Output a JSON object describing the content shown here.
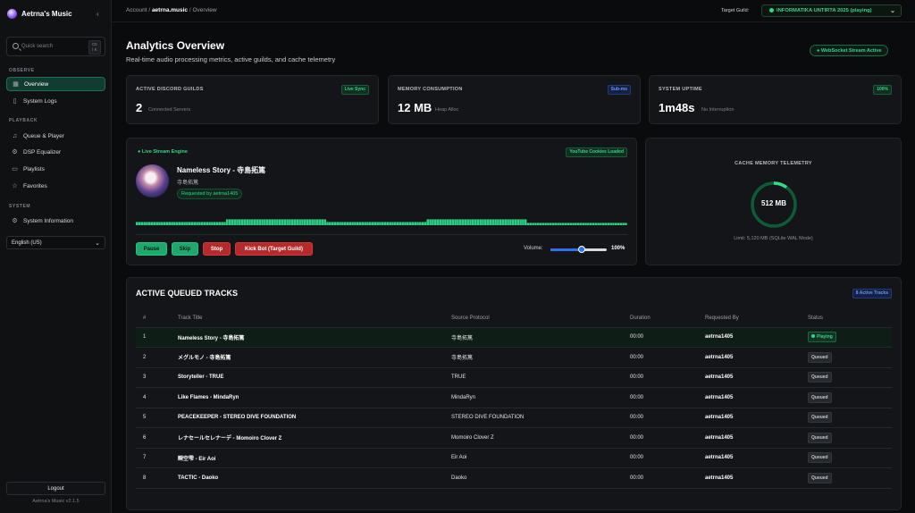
{
  "app": {
    "name": "Aetrna's Music",
    "version": "Aetrna's Music v2.1.5"
  },
  "search": {
    "placeholder": "Quick search",
    "shortcut": "Ctrl K"
  },
  "sidebar": {
    "sections": [
      {
        "title": "OBSERVE",
        "items": [
          {
            "label": "Overview",
            "icon": "grid-icon",
            "active": true
          },
          {
            "label": "System Logs",
            "icon": "file-icon"
          }
        ]
      },
      {
        "title": "PLAYBACK",
        "items": [
          {
            "label": "Queue & Player",
            "icon": "music-icon"
          },
          {
            "label": "DSP Equalizer",
            "icon": "sliders-icon"
          },
          {
            "label": "Playlists",
            "icon": "bookmark-icon"
          },
          {
            "label": "Favorites",
            "icon": "star-icon"
          }
        ]
      },
      {
        "title": "SYSTEM",
        "items": [
          {
            "label": "System Information",
            "icon": "gear-icon"
          }
        ]
      }
    ],
    "language": "English (US)",
    "logout": "Logout"
  },
  "breadcrumb": {
    "root": "Account",
    "guild": "aetrna.music",
    "page": "Overview"
  },
  "target_guild": {
    "label": "Target Guild:",
    "value": "INFORMATIKA UNTIRTA 2025 (playing)"
  },
  "header": {
    "title": "Analytics Overview",
    "subtitle": "Real-time audio processing metrics, active guilds, and cache telemetry",
    "ws_badge": "WebSocket Stream Active"
  },
  "stats": [
    {
      "label": "ACTIVE DISCORD GUILDS",
      "value": "2",
      "sub": "Connected Servers",
      "badge": "Live Sync",
      "badge_color": "green"
    },
    {
      "label": "MEMORY CONSUMPTION",
      "value": "12 MB",
      "sub": "Heap Alloc",
      "badge": "Sub-ms",
      "badge_color": "blue"
    },
    {
      "label": "SYSTEM UPTIME",
      "value": "1m48s",
      "sub": "No Interruption",
      "badge": "100%",
      "badge_color": "green"
    }
  ],
  "player": {
    "engine_label": "Live Stream Engine",
    "cookies_badge": "YouTube Cookies Loaded",
    "track": "Nameless Story - 寺島拓篤",
    "artist": "寺島拓篤",
    "requested_by": "Requested by aetrna1405",
    "controls": {
      "pause": "Pause",
      "skip": "Skip",
      "stop": "Stop",
      "kick": "Kick Bot (Target Guild)"
    },
    "volume_label": "Volume:",
    "volume_value": "100%",
    "volume_fraction": 0.55,
    "waveform": [
      0.3,
      0.3,
      0.3,
      0.3,
      0.3,
      0.3,
      0.3,
      0.3,
      0.3,
      0.3,
      0.3,
      0.3,
      0.3,
      0.3,
      0.3,
      0.3,
      0.3,
      0.3,
      0.3,
      0.3,
      0.3,
      0.3,
      0.3,
      0.3,
      0.3,
      0.3,
      0.3,
      0.3,
      0.3,
      0.3,
      0.3,
      0.3,
      0.3,
      0.3,
      0.3,
      0.3,
      0.55,
      0.55,
      0.55,
      0.55,
      0.55,
      0.55,
      0.55,
      0.55,
      0.55,
      0.55,
      0.55,
      0.55,
      0.55,
      0.55,
      0.55,
      0.55,
      0.55,
      0.55,
      0.55,
      0.55,
      0.55,
      0.55,
      0.55,
      0.55,
      0.55,
      0.55,
      0.55,
      0.55,
      0.55,
      0.55,
      0.55,
      0.55,
      0.55,
      0.55,
      0.55,
      0.55,
      0.55,
      0.55,
      0.55,
      0.55,
      0.3,
      0.3,
      0.3,
      0.3,
      0.3,
      0.3,
      0.3,
      0.3,
      0.3,
      0.3,
      0.3,
      0.3,
      0.3,
      0.3,
      0.3,
      0.3,
      0.3,
      0.3,
      0.3,
      0.3,
      0.3,
      0.3,
      0.3,
      0.3,
      0.3,
      0.3,
      0.3,
      0.3,
      0.3,
      0.3,
      0.3,
      0.3,
      0.3,
      0.3,
      0.3,
      0.3,
      0.3,
      0.3,
      0.3,
      0.3,
      0.55,
      0.55,
      0.55,
      0.55,
      0.55,
      0.55,
      0.55,
      0.55,
      0.55,
      0.55,
      0.55,
      0.55,
      0.55,
      0.55,
      0.55,
      0.55,
      0.55,
      0.55,
      0.55,
      0.55,
      0.55,
      0.55,
      0.55,
      0.55,
      0.55,
      0.55,
      0.55,
      0.55,
      0.55,
      0.55,
      0.55,
      0.55,
      0.55,
      0.55,
      0.55,
      0.55,
      0.55,
      0.55,
      0.55,
      0.55,
      0.22,
      0.22,
      0.22,
      0.22,
      0.22,
      0.22,
      0.22,
      0.22,
      0.22,
      0.22,
      0.22,
      0.22,
      0.22,
      0.22,
      0.22,
      0.22,
      0.22,
      0.22,
      0.22,
      0.22,
      0.22,
      0.22,
      0.22,
      0.22,
      0.22,
      0.22,
      0.22,
      0.22,
      0.22,
      0.22,
      0.22,
      0.22,
      0.22,
      0.22,
      0.22,
      0.22,
      0.22,
      0.22,
      0.22,
      0.22
    ]
  },
  "telemetry": {
    "title": "CACHE MEMORY TELEMETRY",
    "value": "512 MB",
    "fill_fraction": 0.1,
    "limit": "Limit: 5,120 MB (SQLite WAL Mode)"
  },
  "queue": {
    "title": "ACTIVE QUEUED TRACKS",
    "badge": "8 Active Tracks",
    "columns": [
      "#",
      "Track Title",
      "Source Protocol",
      "Duration",
      "Requested By",
      "Status"
    ],
    "rows": [
      {
        "n": "1",
        "title": "Nameless Story - 寺島拓篤",
        "source": "寺島拓篤",
        "duration": "00:00",
        "by": "aetrna1405",
        "status": "Playing"
      },
      {
        "n": "2",
        "title": "メグルモノ - 寺島拓篤",
        "source": "寺島拓篤",
        "duration": "00:00",
        "by": "aetrna1405",
        "status": "Queued"
      },
      {
        "n": "3",
        "title": "Storyteller - TRUE",
        "source": "TRUE",
        "duration": "00:00",
        "by": "aetrna1405",
        "status": "Queued"
      },
      {
        "n": "4",
        "title": "Like Flames - MindaRyn",
        "source": "MindaRyn",
        "duration": "00:00",
        "by": "aetrna1405",
        "status": "Queued"
      },
      {
        "n": "5",
        "title": "PEACEKEEPER - STEREO DIVE FOUNDATION",
        "source": "STEREO DIVE FOUNDATION",
        "duration": "00:00",
        "by": "aetrna1405",
        "status": "Queued"
      },
      {
        "n": "6",
        "title": "レナセールセレナーデ - Momoiro Clover Z",
        "source": "Momoiro Clover Z",
        "duration": "00:00",
        "by": "aetrna1405",
        "status": "Queued"
      },
      {
        "n": "7",
        "title": "瞬空雫 - Eir Aoi",
        "source": "Eir Aoi",
        "duration": "00:00",
        "by": "aetrna1405",
        "status": "Queued"
      },
      {
        "n": "8",
        "title": "TACTIC - Daoko",
        "source": "Daoko",
        "duration": "00:00",
        "by": "aetrna1405",
        "status": "Queued"
      }
    ]
  },
  "colors": {
    "accent": "#1fa86d",
    "danger": "#b52a2a",
    "info": "#2f6ff2",
    "background": "#0a0b0d"
  }
}
